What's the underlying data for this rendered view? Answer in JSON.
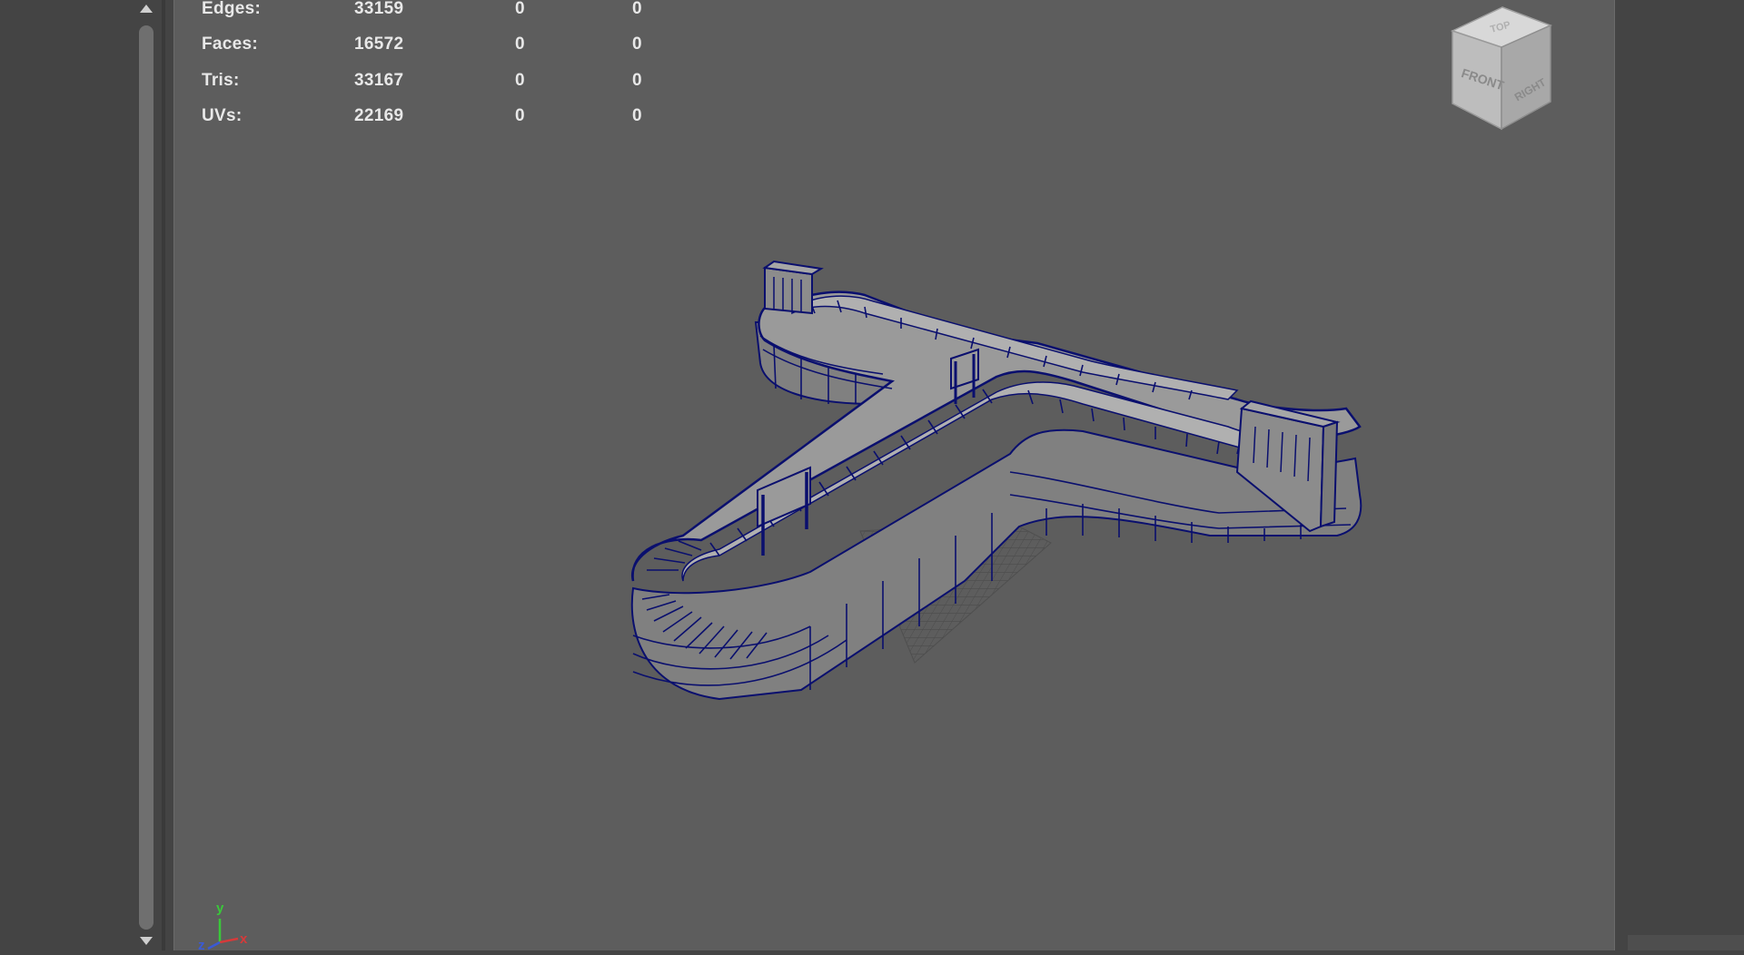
{
  "stats": {
    "rows": [
      {
        "label": "Edges:",
        "v1": "33159",
        "v2": "0",
        "v3": "0"
      },
      {
        "label": "Faces:",
        "v1": "16572",
        "v2": "0",
        "v3": "0"
      },
      {
        "label": "Tris:",
        "v1": "33167",
        "v2": "0",
        "v3": "0"
      },
      {
        "label": "UVs:",
        "v1": "22169",
        "v2": "0",
        "v3": "0"
      }
    ]
  },
  "viewcube": {
    "front": "FRONT",
    "right": "RIGHT",
    "top": "TOP"
  },
  "axis": {
    "x": "x",
    "y": "y",
    "z": "z"
  },
  "colors": {
    "viewport_bg": "#5d5d5d",
    "panel_bg": "#444444",
    "wireframe": "#0a0f6e",
    "mesh_fill": "#8a8a8a",
    "hud_text": "#e8e8e8",
    "axis_x": "#d63a3a",
    "axis_y": "#3ac83a",
    "axis_z": "#3a5ad6"
  },
  "icons": [
    "scroll-up-arrow-icon",
    "scroll-down-arrow-icon",
    "viewcube-icon",
    "axis-gizmo-icon"
  ]
}
